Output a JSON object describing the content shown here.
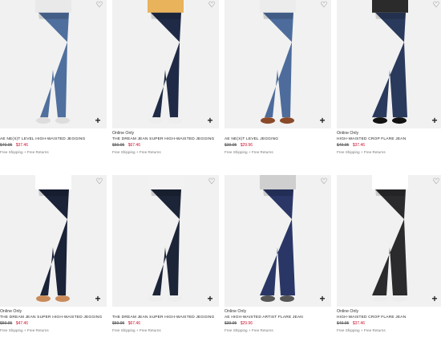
{
  "icons": {
    "wishlist": "heart-outline-icon",
    "quick_add": "plus-icon"
  },
  "colors": {
    "sale": "#c8102e",
    "image_bg": "#f1f1f1"
  },
  "products": [
    {
      "badge": "",
      "name": "AE Ne(x)t Level High-Waisted Jegging",
      "orig": "$49.95",
      "sale": "$37.46",
      "shipping": "Free Shipping + Free Returns",
      "wash": "#4f6f9e"
    },
    {
      "badge": "Online Only",
      "name": "The Dream Jean Super High-Waisted Jegging",
      "orig": "$59.95",
      "sale": "$67.46",
      "shipping": "Free Shipping + Free Returns",
      "wash": "#1f2b46"
    },
    {
      "badge": "",
      "name": "AE Ne(x)t Level Jegging",
      "orig": "$39.95",
      "sale": "$29.96",
      "shipping": "Free Shipping + Free Returns",
      "wash": "#4d6c9c"
    },
    {
      "badge": "Online Only",
      "name": "High-Waisted Crop Flare Jean",
      "orig": "$49.95",
      "sale": "$37.46",
      "shipping": "Free Shipping + Free Returns",
      "wash": "#2a3a5c"
    },
    {
      "badge": "Online Only",
      "name": "The Dream Jean Super High-Waisted Jegging",
      "orig": "$59.95",
      "sale": "$47.46",
      "shipping": "Free Shipping + Free Returns",
      "wash": "#1a2338"
    },
    {
      "badge": "",
      "name": "The Dream Jean Super High-Waisted Jegging",
      "orig": "$59.95",
      "sale": "$67.46",
      "shipping": "Free Shipping + Free Returns",
      "wash": "#1c2538"
    },
    {
      "badge": "Online Only",
      "name": "AE High-Waisted Artist Flare Jean",
      "orig": "$39.95",
      "sale": "$29.96",
      "shipping": "Free Shipping + Free Returns",
      "wash": "#2a3766"
    },
    {
      "badge": "Online Only",
      "name": "High-Waisted Crop Flare Jean",
      "orig": "$49.95",
      "sale": "$37.46",
      "shipping": "Free Shipping + Free Returns",
      "wash": "#2b2b2d"
    }
  ]
}
